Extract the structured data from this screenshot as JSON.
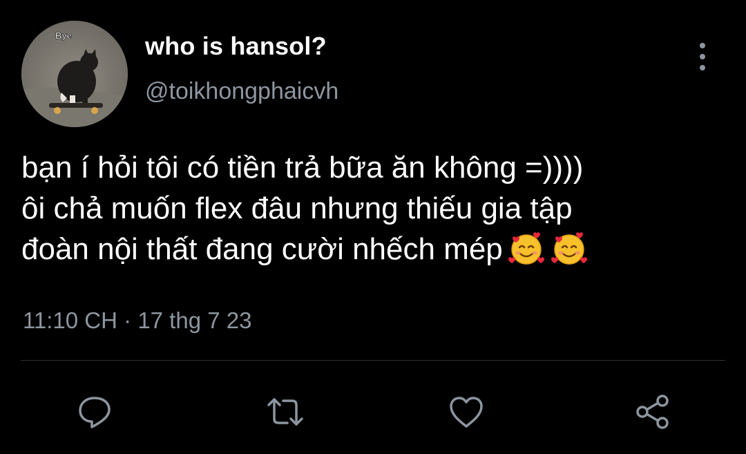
{
  "author": {
    "display_name": "who is hansol?",
    "handle": "@toikhongphaicvh",
    "avatar_caption": "Bye"
  },
  "tweet": {
    "text": "bạn í hỏi tôi có tiền trả bữa ăn không =))))\nôi chả muốn flex đâu nhưng thiếu gia tập\nđoàn nội thất đang cười nhếch mép",
    "emojis": [
      "smiling-face-with-hearts",
      "smiling-face-with-hearts"
    ],
    "time": "11:10 CH",
    "separator": "·",
    "date": "17 thg 7 23"
  },
  "actions": [
    "reply-icon",
    "retweet-icon",
    "like-icon",
    "share-icon"
  ],
  "more_menu_icon": "more-vertical-icon",
  "colors": {
    "background": "#000000",
    "text": "#ffffff",
    "muted": "#8d96a0",
    "divider": "#2f3336"
  }
}
